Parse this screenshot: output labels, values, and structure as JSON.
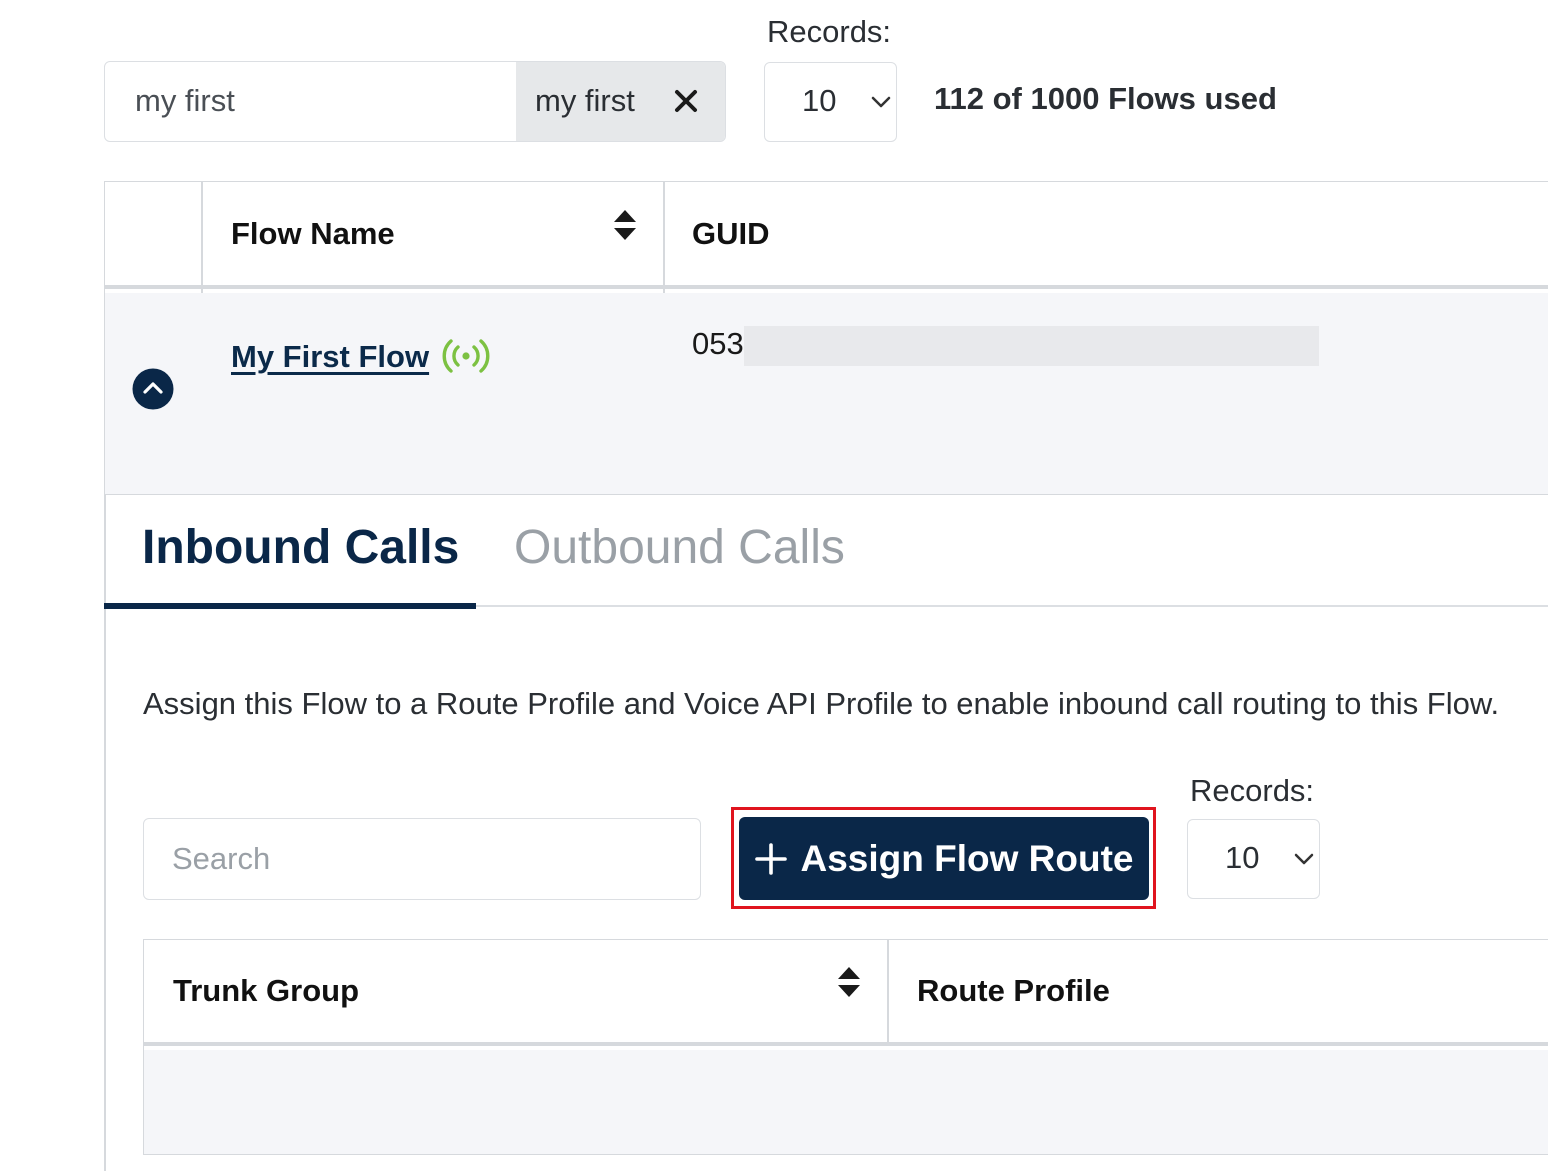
{
  "filter": {
    "input_value": "my first",
    "chip_label": "my first"
  },
  "records_top": {
    "label": "Records:",
    "selected": "10"
  },
  "usage_text": "112 of 1000 Flows used",
  "flows_table": {
    "columns": [
      "Flow Name",
      "GUID"
    ],
    "rows": [
      {
        "name": "My First Flow",
        "guid_prefix": "053"
      }
    ]
  },
  "tabs": [
    {
      "label": "Inbound Calls",
      "active": true
    },
    {
      "label": "Outbound Calls",
      "active": false
    }
  ],
  "inbound": {
    "description": "Assign this Flow to a Route Profile and Voice API Profile to enable inbound call routing to this Flow.",
    "search_placeholder": "Search",
    "assign_button_label": "Assign Flow Route",
    "records_label": "Records:",
    "records_selected": "10",
    "columns": [
      "Trunk Group",
      "Route Profile"
    ]
  },
  "colors": {
    "primary": "#0a2748",
    "live_icon": "#7cc142",
    "highlight": "#e0141e"
  }
}
